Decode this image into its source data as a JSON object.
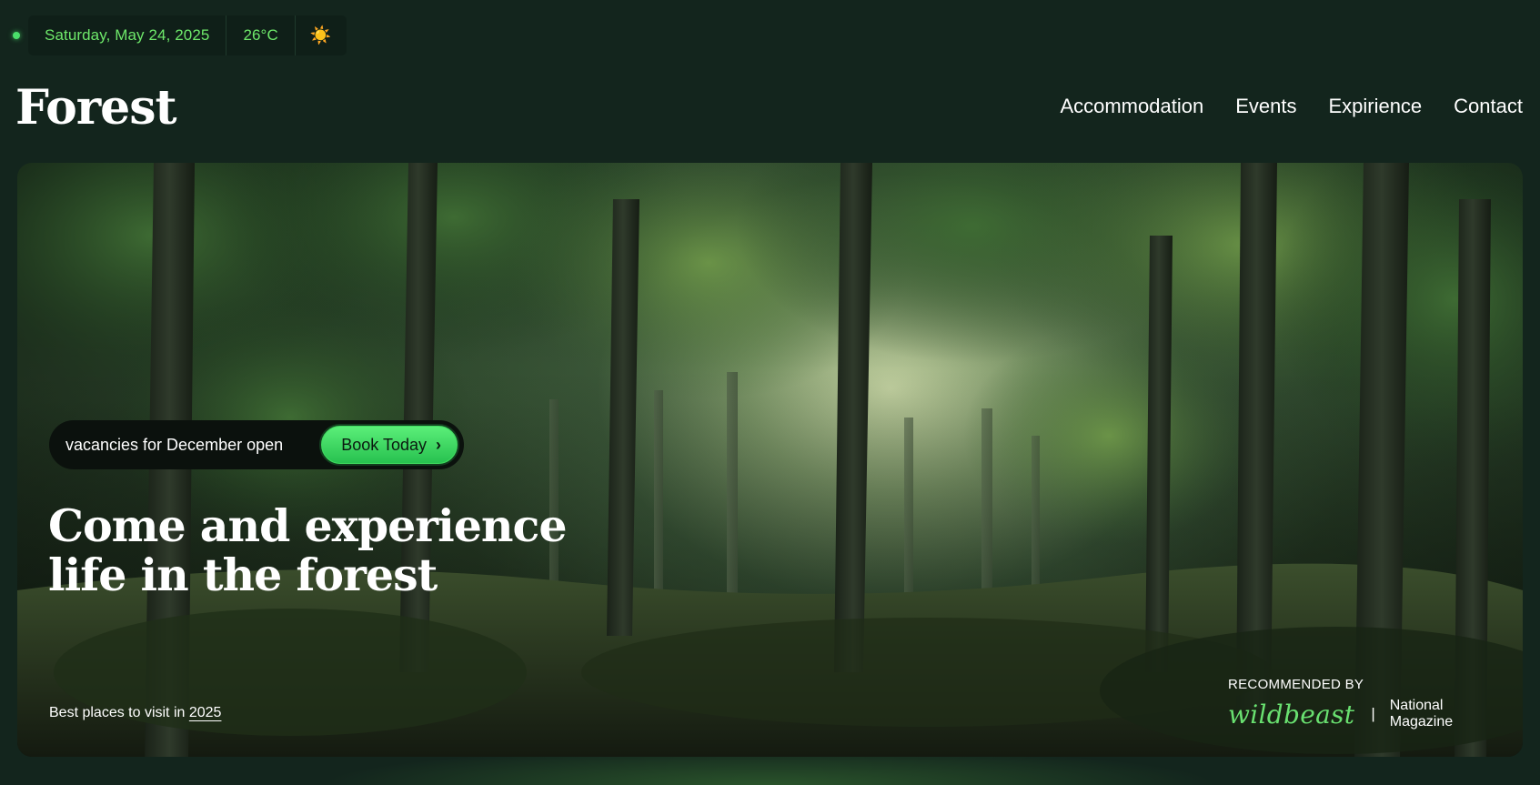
{
  "status": {
    "date": "Saturday, May 24, 2025",
    "temperature": "26°C",
    "weather_icon": "sun-icon",
    "weather_glyph": "☀️"
  },
  "header": {
    "brand": "Forest",
    "nav": [
      "Accommodation",
      "Events",
      "Expirience",
      "Contact"
    ]
  },
  "hero": {
    "vacancy_text": "vacancies for December open",
    "book_button": "Book Today",
    "book_icon": "chevron-right-icon",
    "book_glyph": "›",
    "title_line1": "Come and experience",
    "title_line2": "life in the forest",
    "best_places_prefix": "Best places to visit in",
    "best_places_year": "2025",
    "recommended_label": "RECOMMENDED BY",
    "recommended_brand": "wildbeast",
    "recommended_separator": "|",
    "recommended_magazine": "National Magazine"
  },
  "colors": {
    "background": "#13251d",
    "accent_green": "#4ade6a",
    "status_text": "#6ee86a"
  }
}
